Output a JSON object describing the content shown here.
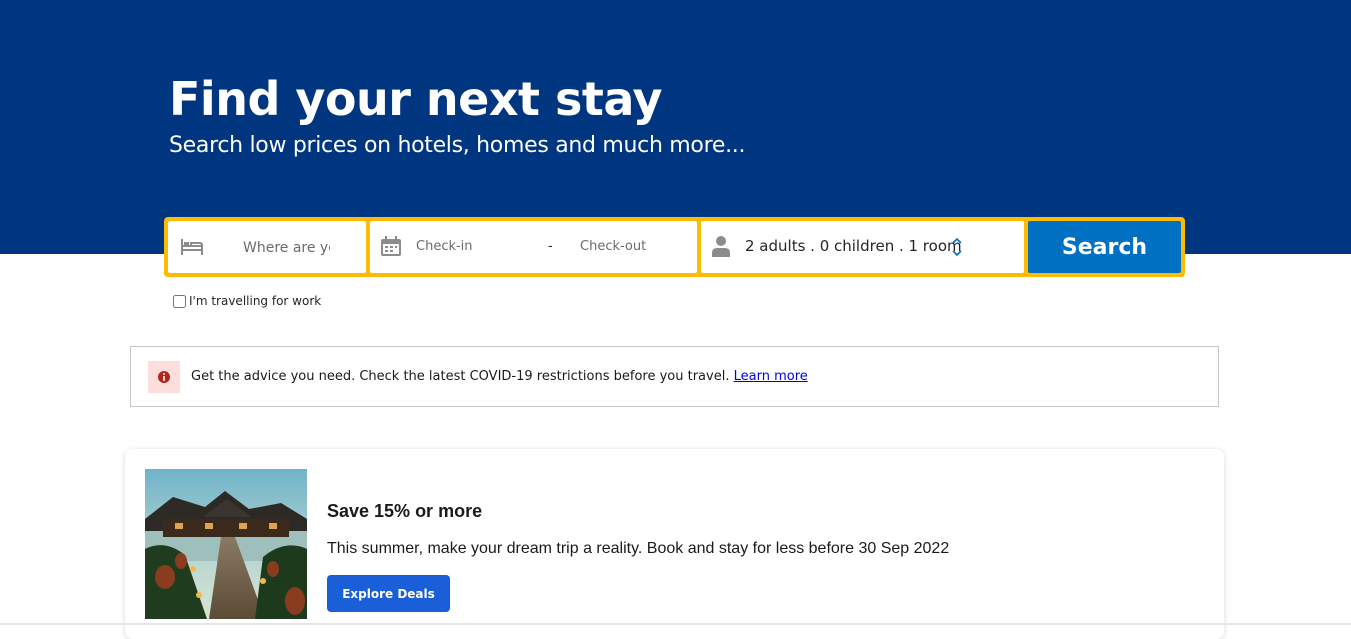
{
  "hero": {
    "title": "Find your next stay",
    "subtitle": "Search low prices on hotels, homes and much more..."
  },
  "search": {
    "destination_placeholder": "Where are you going?",
    "checkin_label": "Check-in",
    "date_separator": "-",
    "checkout_label": "Check-out",
    "guests_summary": "2 adults . 0 children . 1 room",
    "search_button": "Search",
    "work_travel_label": "I'm travelling for work",
    "work_travel_checked": false
  },
  "notice": {
    "text": "Get the advice you need. Check the latest COVID-19 restrictions before you travel.",
    "link": "Learn more"
  },
  "deal": {
    "title": "Save 15% or more",
    "text": "This summer, make your dream trip a reality. Book and stay for less before 30 Sep 2022",
    "button": "Explore Deals"
  },
  "colors": {
    "brand_blue": "#003580",
    "search_border": "#febb02",
    "search_button": "#0071c2",
    "deal_button": "#1a5fd8"
  },
  "icons": [
    "bed-icon",
    "calendar-icon",
    "person-icon",
    "stepper-icon",
    "info-icon"
  ]
}
